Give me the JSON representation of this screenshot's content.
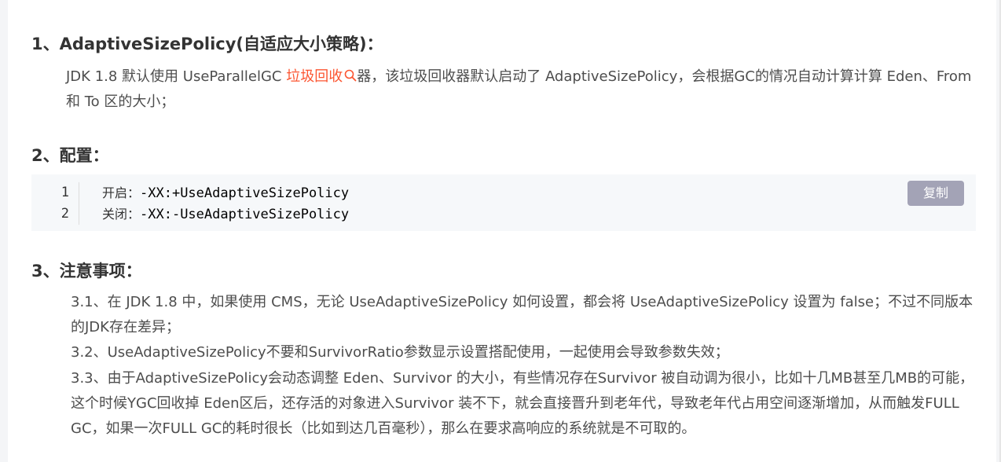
{
  "sections": [
    {
      "heading": "1、AdaptiveSizePolicy(自适应大小策略)：",
      "para_before": "JDK 1.8 默认使用 UseParallelGC ",
      "link_text": "垃圾回收",
      "para_after": "器，该垃圾回收器默认启动了 AdaptiveSizePolicy，会根据GC的情况自动计算计算 Eden、From 和 To 区的大小；"
    },
    {
      "heading": "2、配置："
    },
    {
      "heading": "3、注意事项：",
      "items": [
        "3.1、在 JDK 1.8 中，如果使用 CMS，无论 UseAdaptiveSizePolicy 如何设置，都会将 UseAdaptiveSizePolicy 设置为 false；不过不同版本的JDK存在差异；",
        "3.2、UseAdaptiveSizePolicy不要和SurvivorRatio参数显示设置搭配使用，一起使用会导致参数失效；",
        "3.3、由于AdaptiveSizePolicy会动态调整 Eden、Survivor 的大小，有些情况存在Survivor 被自动调为很小，比如十几MB甚至几MB的可能，这个时候YGC回收掉 Eden区后，还存活的对象进入Survivor 装不下，就会直接晋升到老年代，导致老年代占用空间逐渐增加，从而触发FULL GC，如果一次FULL GC的耗时很长（比如到达几百毫秒），那么在要求高响应的系统就是不可取的。"
      ]
    }
  ],
  "code": {
    "copy_label": "复制",
    "lines": [
      {
        "num": "1",
        "label": "开启：",
        "code": "-XX:+UseAdaptiveSizePolicy"
      },
      {
        "num": "2",
        "label": "关闭：",
        "code": "-XX:-UseAdaptiveSizePolicy"
      }
    ]
  },
  "colors": {
    "link": "#fc5531",
    "copy_button": "#a3a3b6",
    "code_bg": "#f6f8fa"
  },
  "icons": {
    "link_icon": "search-icon"
  }
}
